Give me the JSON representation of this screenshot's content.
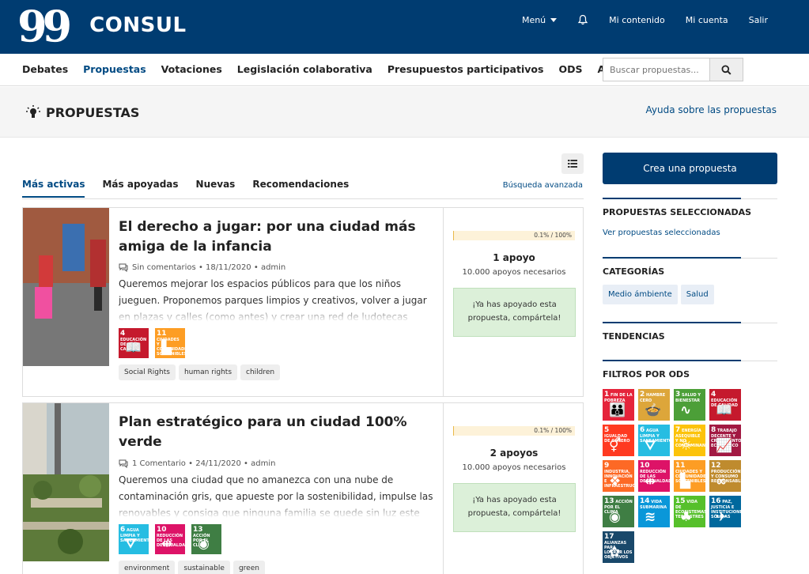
{
  "header": {
    "logo_text": "CONSUL",
    "menu_label": "Menú",
    "notifications_icon": "bell-icon",
    "links": [
      "Mi contenido",
      "Mi cuenta",
      "Salir"
    ],
    "bg_color": "#003c71"
  },
  "nav": {
    "items": [
      {
        "label": "Debates"
      },
      {
        "label": "Propuestas",
        "active": true
      },
      {
        "label": "Votaciones"
      },
      {
        "label": "Legislación colaborativa"
      },
      {
        "label": "Presupuestos participativos"
      },
      {
        "label": "ODS"
      },
      {
        "label": "Ayuda"
      }
    ],
    "search_placeholder": "Buscar propuestas...",
    "search_icon": "search-icon"
  },
  "section": {
    "title": "PROPUESTAS",
    "icon": "lightbulb-icon",
    "help_link": "Ayuda sobre las propuestas"
  },
  "tabs": {
    "items": [
      "Más activas",
      "Más apoyadas",
      "Nuevas",
      "Recomendaciones"
    ],
    "active_index": 0,
    "advanced_search": "Búsqueda avanzada",
    "view_toggle_icon": "list-view-icon"
  },
  "proposals": [
    {
      "title": "El derecho a jugar: por una ciudad más amiga de la infancia",
      "comments": "Sin comentarios",
      "date": "18/11/2020",
      "author": "admin",
      "description": "Queremos mejorar los espacios públicos para que los niños jueguen. Proponemos parques limpios y creativos, volver a jugar en plazas y calles (como antes) y crear una red de ludotecas públicas",
      "ods": [
        {
          "num": "4",
          "label": "EDUCACIÓN DE CALIDAD",
          "color": "#c5192d",
          "glyph": "📖"
        },
        {
          "num": "11",
          "label": "CIUDADES Y COMUNIDADES SOSTENIBLES",
          "color": "#fd9d24",
          "glyph": "▙"
        }
      ],
      "tags": [
        "Social Rights",
        "human rights",
        "children"
      ],
      "progress_label": "0.1% / 100%",
      "progress_fraction": 0.001,
      "supports": "1 apoyo",
      "needed": "10.000 apoyos necesarios",
      "supported_msg": "¡Ya has apoyado esta propuesta, compártela!"
    },
    {
      "title": "Plan estratégico para un ciudad 100% verde",
      "comments": "1 Comentario",
      "date": "24/11/2020",
      "author": "admin",
      "description": "Queremos una ciudad que no amanezca con una nube de contaminación gris, que apueste por la sostenibilidad, impulse las renovables y consiga que ninguna familia se quede sin luz este",
      "ods": [
        {
          "num": "6",
          "label": "AGUA LIMPIA Y SANEAMIENTO",
          "color": "#26bde2",
          "glyph": "⛛"
        },
        {
          "num": "10",
          "label": "REDUCCIÓN DE LAS DESIGUALDADES",
          "color": "#dd1367",
          "glyph": "⇹"
        },
        {
          "num": "13",
          "label": "ACCIÓN POR EL CLIMA",
          "color": "#3f7e44",
          "glyph": "◉"
        }
      ],
      "tags": [
        "environment",
        "sustainable",
        "green"
      ],
      "progress_label": "0.1% / 100%",
      "progress_fraction": 0.001,
      "supports": "2 apoyos",
      "needed": "10.000 apoyos necesarios",
      "supported_msg": "¡Ya has apoyado esta propuesta, compártela!"
    }
  ],
  "sidebar": {
    "create_button": "Crea una propuesta",
    "selected_heading": "PROPUESTAS SELECCIONADAS",
    "selected_link": "Ver propuestas seleccionadas",
    "categories_heading": "CATEGORÍAS",
    "categories": [
      "Medio ámbiente",
      "Salud"
    ],
    "trends_heading": "TENDENCIAS",
    "ods_heading": "FILTROS POR ODS",
    "ods_filters": [
      {
        "num": "1",
        "label": "FIN DE LA POBREZA",
        "color": "#e5243b",
        "glyph": "👪"
      },
      {
        "num": "2",
        "label": "HAMBRE CERO",
        "color": "#dda63a",
        "glyph": "🍲"
      },
      {
        "num": "3",
        "label": "SALUD Y BIENESTAR",
        "color": "#4c9f38",
        "glyph": "∿"
      },
      {
        "num": "4",
        "label": "EDUCACIÓN DE CALIDAD",
        "color": "#c5192d",
        "glyph": "📖"
      },
      {
        "num": "5",
        "label": "IGUALDAD DE GÉNERO",
        "color": "#ff3a21",
        "glyph": "⚥"
      },
      {
        "num": "6",
        "label": "AGUA LIMPIA Y SANEAMIENTO",
        "color": "#26bde2",
        "glyph": "⛛"
      },
      {
        "num": "7",
        "label": "ENERGÍA ASEQUIBLE Y NO CONTAMINANTE",
        "color": "#fcc30b",
        "glyph": "☼"
      },
      {
        "num": "8",
        "label": "TRABAJO DECENTE Y CRECIMIENTO ECONÓMICO",
        "color": "#a21942",
        "glyph": "📈"
      },
      {
        "num": "9",
        "label": "INDUSTRIA, INNOVACIÓN E INFRAESTRUCTURA",
        "color": "#fd6925",
        "glyph": "❖"
      },
      {
        "num": "10",
        "label": "REDUCCIÓN DE LAS DESIGUALDADES",
        "color": "#dd1367",
        "glyph": "⇹"
      },
      {
        "num": "11",
        "label": "CIUDADES Y COMUNIDADES SOSTENIBLES",
        "color": "#fd9d24",
        "glyph": "▙"
      },
      {
        "num": "12",
        "label": "PRODUCCIÓN Y CONSUMO RESPONSABLES",
        "color": "#bf8b2e",
        "glyph": "∞"
      },
      {
        "num": "13",
        "label": "ACCIÓN POR EL CLIMA",
        "color": "#3f7e44",
        "glyph": "◉"
      },
      {
        "num": "14",
        "label": "VIDA SUBMARINA",
        "color": "#0a97d9",
        "glyph": "≋"
      },
      {
        "num": "15",
        "label": "VIDA DE ECOSISTEMAS TERRESTRES",
        "color": "#56c02b",
        "glyph": "♣"
      },
      {
        "num": "16",
        "label": "PAZ, JUSTICIA E INSTITUCIONES SÓLIDAS",
        "color": "#00689d",
        "glyph": "✈"
      },
      {
        "num": "17",
        "label": "ALIANZAS PARA LOGRAR LOS OBJETIVOS",
        "color": "#19486a",
        "glyph": "✿"
      }
    ]
  }
}
